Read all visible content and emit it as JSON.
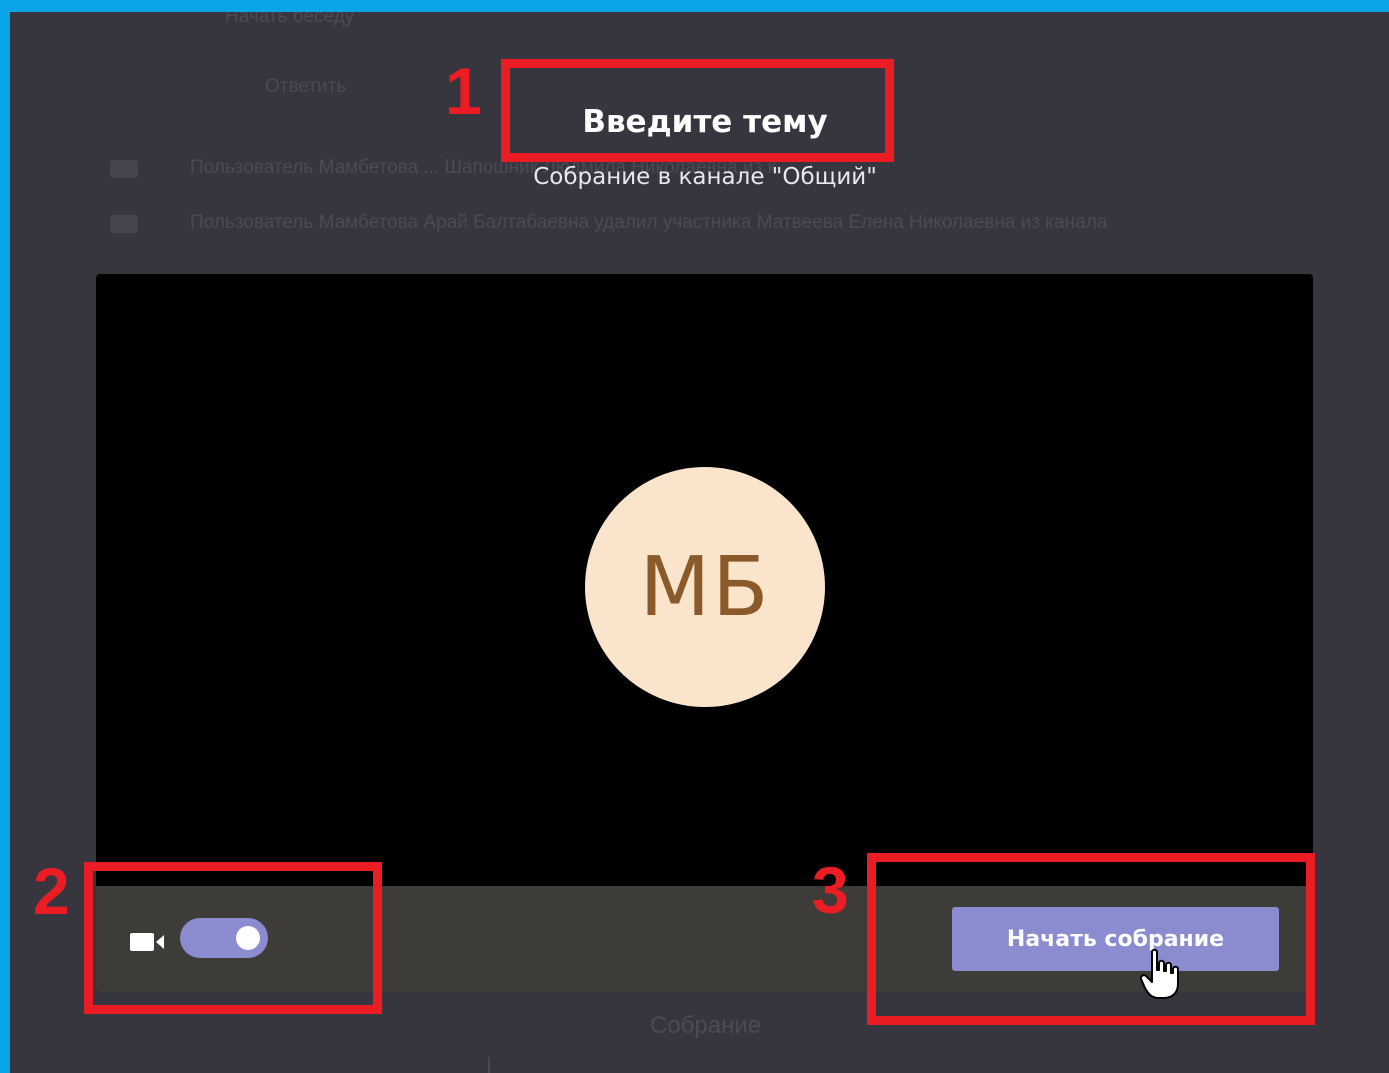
{
  "dialog": {
    "title": "Введите тему",
    "subtitle": "Собрание в канале \"Общий\""
  },
  "preview": {
    "avatar_initials": "МБ",
    "camera_toggle_on": true,
    "start_button_label": "Начать собрание"
  },
  "background": {
    "lines": [
      "Начать беседу",
      "Ответить",
      "Пользователь Мамбетова ... Шапошник Людмила Николаевна из к",
      "Пользователь Мамбетова Арай Балтабаевна удалил участника Матвеева Елена Николаевна из канала",
      "Собрание"
    ]
  },
  "annotations": {
    "labels": [
      "1",
      "2",
      "3"
    ]
  },
  "colors": {
    "frame_border": "#0aa4e8",
    "background": "#37363f",
    "annotation_red": "#ec1c24",
    "accent": "#8b8bcf",
    "avatar_bg": "#fbe4cc",
    "avatar_text": "#8a5a2b"
  },
  "icons": {
    "camera": "video-camera-icon",
    "cursor": "hand-pointer-cursor"
  }
}
